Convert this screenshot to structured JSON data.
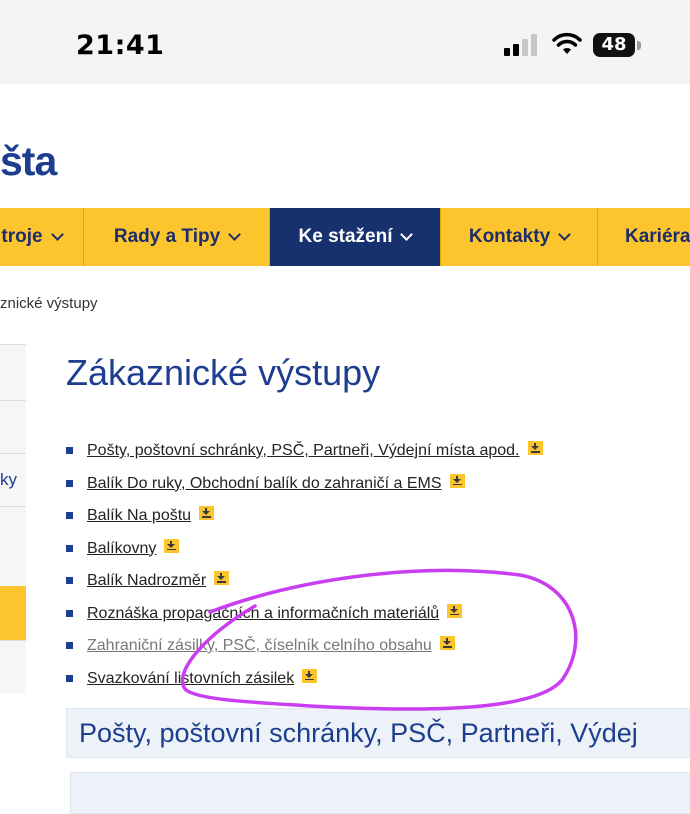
{
  "status_bar": {
    "time": "21:41",
    "battery": "48"
  },
  "logo": {
    "text": "šta"
  },
  "nav": {
    "items": [
      {
        "label": "troje"
      },
      {
        "label": "Rady a Tipy"
      },
      {
        "label": "Ke stažení",
        "active": true
      },
      {
        "label": "Kontakty"
      },
      {
        "label": "Kariéra"
      }
    ]
  },
  "breadcrumb": "znické výstupy",
  "sidebar": {
    "fragment_text": "ky"
  },
  "main": {
    "title": "Zákaznické výstupy",
    "links": [
      {
        "label": "Pošty, poštovní schránky, PSČ, Partneři, Výdejní místa apod.",
        "icon": "download-icon"
      },
      {
        "label": "Balík Do ruky, Obchodní balík do zahraničí a EMS",
        "icon": "download-icon"
      },
      {
        "label": "Balík Na poštu",
        "icon": "download-icon"
      },
      {
        "label": "Balíkovny",
        "icon": "download-icon"
      },
      {
        "label": "Balík Nadrozměr",
        "icon": "download-icon"
      },
      {
        "label": "Roznáška propagačních a informačních materiálů",
        "icon": "download-icon"
      },
      {
        "label": "Zahraniční zásilky, PSČ, číselník celního obsahu",
        "icon": "download-icon",
        "visited": true
      },
      {
        "label": "Svazkování listovních zásilek",
        "icon": "download-icon"
      }
    ],
    "section_heading": "Pošty, poštovní schránky, PSČ, Partneři, Výdej"
  },
  "colors": {
    "brand_blue": "#1d3d8f",
    "nav_yellow": "#fdc52d",
    "nav_active": "#17306e",
    "annotation_purple": "#c93ef0"
  }
}
